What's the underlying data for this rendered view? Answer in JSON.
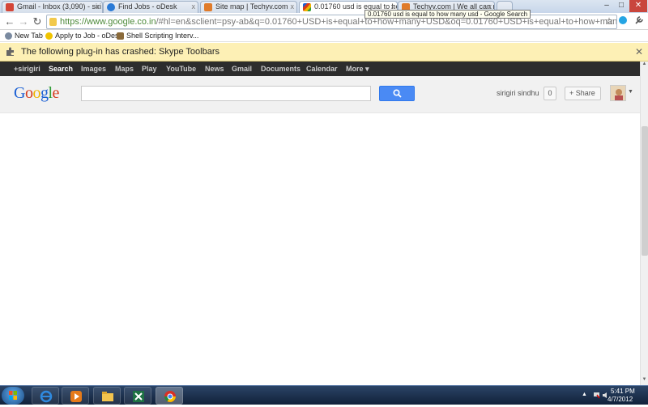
{
  "window": {
    "minimize": "–",
    "maximize": "□",
    "close": "✕"
  },
  "tabs": [
    {
      "label": "Gmail - Inbox (3,090) - siri",
      "active": false
    },
    {
      "label": "Find Jobs - oDesk",
      "active": false
    },
    {
      "label": "Site map | Techyv.com",
      "active": false
    },
    {
      "label": "0.01760 usd is equal to how",
      "active": true
    },
    {
      "label": "Techyv.com | We all can m",
      "active": false
    }
  ],
  "tooltip": "0.01760 usd is equal to how many usd - Google Search",
  "toolbar": {
    "url_host": "https://www.google.co.in",
    "url_rest": "/#hl=en&sclient=psy-ab&q=0.01760+USD+is+equal+to+how+many+USD&oq=0.01760+USD+is+equal+to+how+many+USD&aq=f&aq"
  },
  "bookmarks": [
    {
      "label": "New Tab"
    },
    {
      "label": "Apply to Job - oDesk"
    },
    {
      "label": "Shell Scripting Interv..."
    }
  ],
  "infobar": {
    "message": "The following plug-in has crashed: Skype Toolbars",
    "close": "✕"
  },
  "gbar": {
    "items": [
      "+sirigiri",
      "Search",
      "Images",
      "Maps",
      "Play",
      "YouTube",
      "News",
      "Gmail",
      "Documents",
      "Calendar",
      "More ▾"
    ]
  },
  "header": {
    "logo_letters": [
      "G",
      "o",
      "o",
      "g",
      "l",
      "e"
    ],
    "user_name": "sirigiri sindhu",
    "notification_count": "0",
    "share_label": "+ Share"
  },
  "colors": {
    "logo": [
      "#1a5fd4",
      "#d63a1c",
      "#f0b400",
      "#1a5fd4",
      "#2d9b33",
      "#d63a1c"
    ],
    "search_button": "#4a8af4",
    "infobar_bg": "#fdf0b5"
  },
  "taskbar": {
    "apps": [
      "internet-explorer",
      "windows-media-player",
      "windows-explorer",
      "microsoft-excel",
      "google-chrome"
    ],
    "time": "5:41 PM",
    "date": "4/7/2012"
  }
}
